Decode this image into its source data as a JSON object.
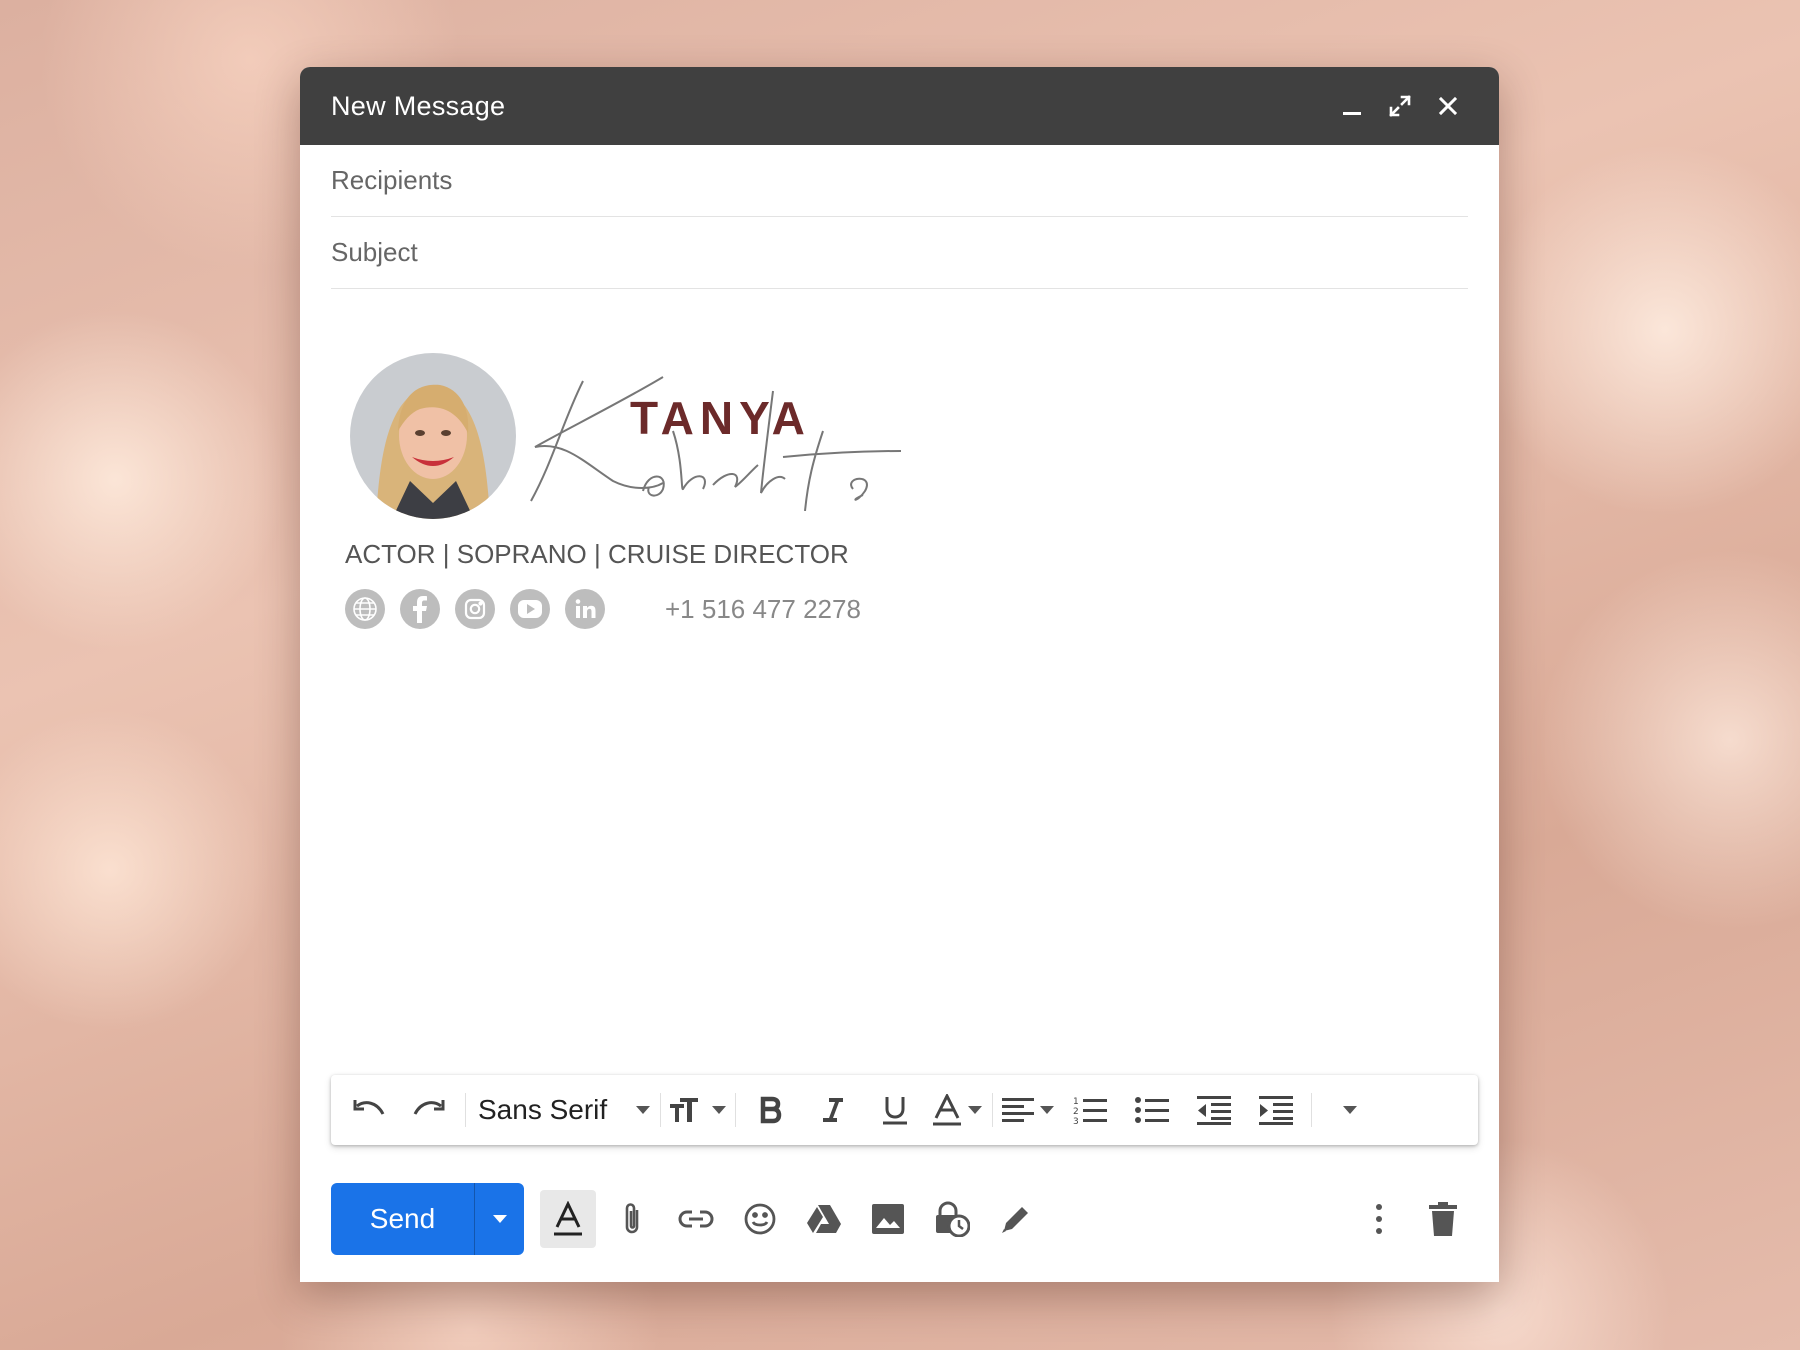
{
  "window": {
    "title": "New Message",
    "controls": [
      "minimize-icon",
      "fullscreen-icon",
      "close-icon"
    ]
  },
  "fields": {
    "recipients_placeholder": "Recipients",
    "subject_placeholder": "Subject"
  },
  "signature": {
    "first_name": "TANYA",
    "script_name": "Roberts",
    "tagline": "ACTOR | SOPRANO | CRUISE DIRECTOR",
    "phone": "+1 516 477 2278",
    "social_icons": [
      "globe-icon",
      "facebook-icon",
      "instagram-icon",
      "youtube-icon",
      "linkedin-icon"
    ]
  },
  "format_toolbar": {
    "font": "Sans Serif",
    "buttons": [
      "undo",
      "redo",
      "font-family",
      "text-size",
      "bold",
      "italic",
      "underline",
      "text-color",
      "align",
      "numbered-list",
      "bulleted-list",
      "indent-less",
      "indent-more",
      "more-formatting"
    ]
  },
  "bottom_toolbar": {
    "send_label": "Send",
    "buttons": [
      "formatting-options",
      "attach-files",
      "insert-link",
      "insert-emoji",
      "insert-drive",
      "insert-photo",
      "confidential-mode",
      "insert-signature",
      "more-options",
      "discard-draft"
    ]
  },
  "colors": {
    "titlebar": "#404040",
    "send": "#1a73e8",
    "name_accent": "#6c2a2a"
  }
}
